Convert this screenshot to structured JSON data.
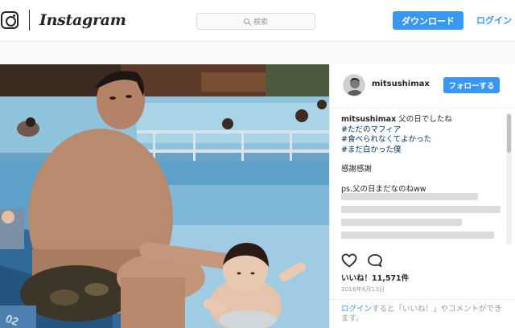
{
  "nav": {
    "wordmark": "Instagram",
    "search_placeholder": "検索",
    "download_label": "ダウンロード",
    "login_label": "ログイン"
  },
  "post": {
    "username": "mitsushimax",
    "follow_label": "フォローする",
    "caption_text": "父の日でしたね",
    "hashtags": [
      "#ただのマフィア",
      "#食べられなくてよかった",
      "#まだ白かった僕"
    ],
    "line_thanks": "感謝感謝",
    "line_ps": "ps.父の日まだなのねww",
    "likes": "いいね！11,571件",
    "date": "2016年6月13日",
    "comment_login": "ログイン",
    "comment_rest": "すると「いいね！」やコメントができます。"
  },
  "colors": {
    "accent": "#3897f0",
    "hashtag": "#003569",
    "text": "#262626",
    "muted": "#999999"
  },
  "icons": [
    "instagram-camera-icon",
    "search-icon",
    "heart-icon",
    "comment-icon"
  ]
}
